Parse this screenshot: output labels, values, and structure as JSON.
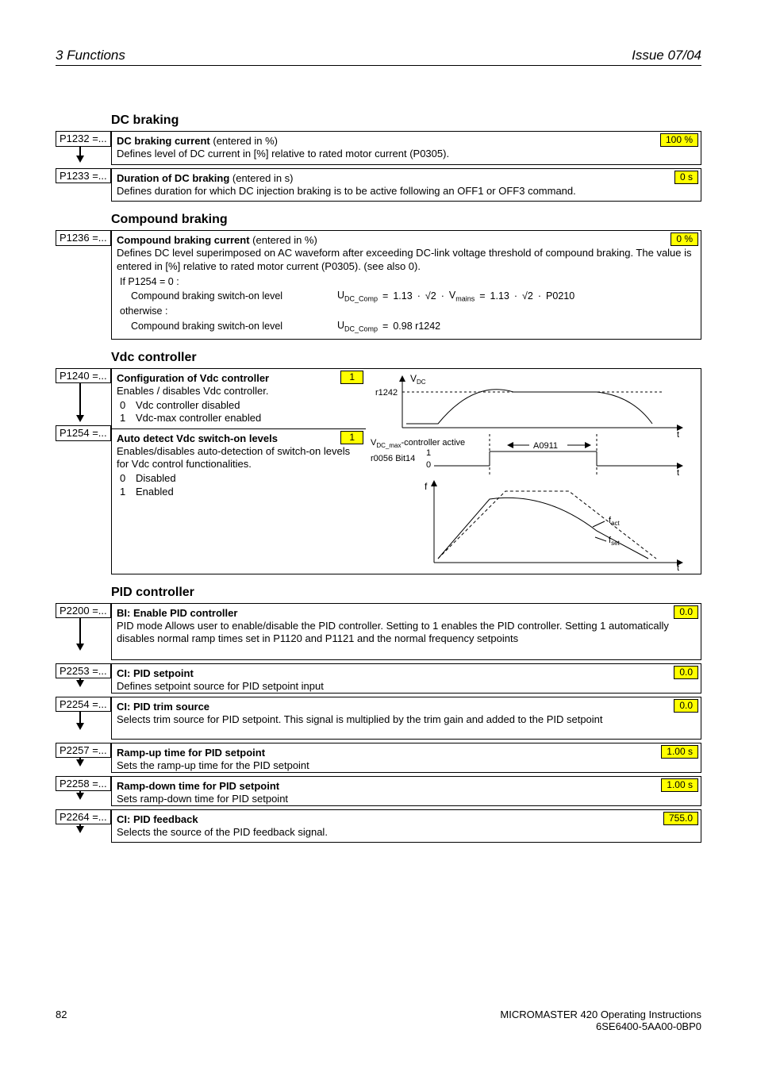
{
  "header": {
    "left": "3  Functions",
    "right": "Issue 07/04"
  },
  "sec_dc": {
    "title": "DC braking"
  },
  "p1232": {
    "param": "P1232 =...",
    "title": "DC braking current",
    "suffix": " (entered in %)",
    "desc": "Defines level of DC current in [%] relative to rated motor current (P0305).",
    "default": "100 %"
  },
  "p1233": {
    "param": "P1233 =...",
    "title": "Duration of DC braking",
    "suffix": " (entered in s)",
    "desc": "Defines duration for which DC injection braking is to be active following an OFF1 or OFF3 command.",
    "default": "0 s"
  },
  "sec_cb": {
    "title": "Compound braking"
  },
  "p1236": {
    "param": "P1236 =...",
    "title": "Compound braking current",
    "suffix": " (entered in %)",
    "desc": "Defines DC level superimposed on AC waveform after exceeding DC-link voltage threshold of compound braking. The value is entered in [%] relative to rated motor current (P0305). (see also 0).",
    "default": "0 %",
    "f1_label": "If P1254 = 0 :",
    "f1_text": "Compound braking switch-on level",
    "f1_rhs_pre": "U",
    "f1_rhs_sub": "DC_Comp",
    "f1_rhs_eq1": "1.13",
    "f1_rhs_sqrt": "√2",
    "f1_rhs_vm": "V",
    "f1_rhs_vmsub": "mains",
    "f1_rhs_eq2": "1.13",
    "f1_rhs_p": "P0210",
    "f2_label": "otherwise :",
    "f2_text": "Compound braking switch-on level",
    "f2_rhs_eq": "0.98  r1242"
  },
  "sec_vdc": {
    "title": "Vdc controller"
  },
  "p1240": {
    "param": "P1240 =...",
    "title": "Configuration of Vdc controller",
    "desc": "Enables / disables Vdc controller.",
    "opt0": "Vdc controller disabled",
    "opt1": "Vdc-max controller enabled",
    "default": "1"
  },
  "p1254": {
    "param": "P1254 =...",
    "title": "Auto detect Vdc switch-on levels",
    "desc": "Enables/disables auto-detection of switch-on levels for Vdc control functionalities.",
    "opt0": "Disabled",
    "opt1": "Enabled",
    "default": "1"
  },
  "vdc_graph": {
    "vdc": "V",
    "vdc_sub": "DC",
    "r1242": "r1242",
    "ctrl_active_pre": "V",
    "ctrl_active_sub": "DC_max",
    "ctrl_active_post": "-controller active",
    "a0911": "A0911",
    "r0056": "r0056 Bit14",
    "one": "1",
    "zero": "0",
    "f": "f",
    "fact": "f",
    "fact_sub": "act",
    "fset": "f",
    "fset_sub": "set",
    "t": "t"
  },
  "sec_pid": {
    "title": "PID controller"
  },
  "p2200": {
    "param": "P2200 =...",
    "title": "BI: Enable PID controller",
    "desc": "PID mode Allows user to enable/disable the PID controller. Setting to 1 enables the PID controller. Setting 1 automatically disables normal ramp times set in P1120 and P1121 and the normal frequency setpoints",
    "default": "0.0"
  },
  "p2253": {
    "param": "P2253 =...",
    "title": "CI: PID setpoint",
    "desc": "Defines setpoint source for PID setpoint input",
    "default": "0.0"
  },
  "p2254": {
    "param": "P2254 =...",
    "title": "CI: PID trim source",
    "desc": "Selects trim source for PID setpoint. This signal is multiplied by the trim gain and added to the PID setpoint",
    "default": "0.0"
  },
  "p2257": {
    "param": "P2257 =...",
    "title": "Ramp-up time for PID setpoint",
    "desc": "Sets the ramp-up time for the PID setpoint",
    "default": "1.00 s"
  },
  "p2258": {
    "param": "P2258 =...",
    "title": "Ramp-down time for PID setpoint",
    "desc": "Sets ramp-down time for PID setpoint",
    "default": "1.00 s"
  },
  "p2264": {
    "param": "P2264 =...",
    "title": "CI: PID feedback",
    "desc": "Selects the source of the PID feedback signal.",
    "default": "755.0"
  },
  "footer": {
    "page": "82",
    "r1": "MICROMASTER 420     Operating Instructions",
    "r2": "6SE6400-5AA00-0BP0"
  }
}
